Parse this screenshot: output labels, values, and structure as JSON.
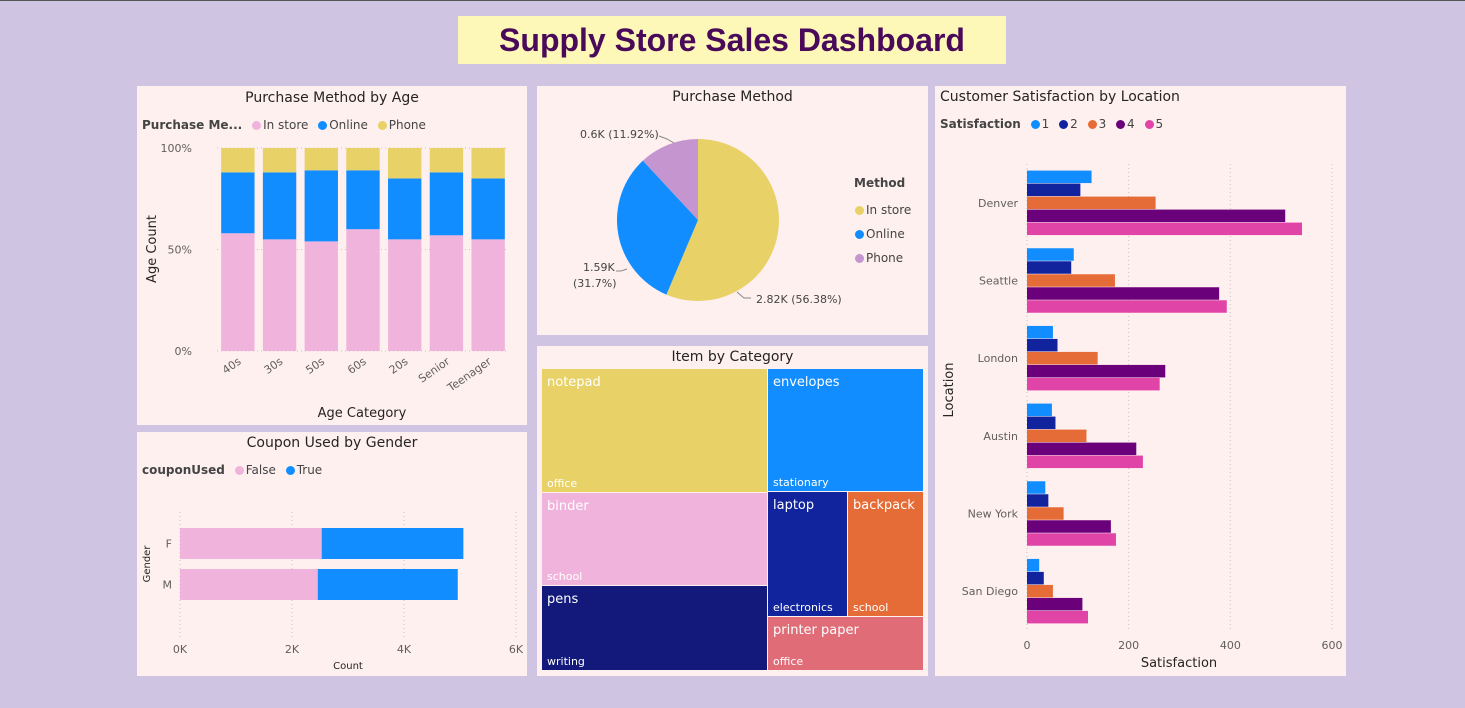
{
  "dashboard": {
    "title": "Supply Store Sales  Dashboard"
  },
  "age_chart": {
    "title": "Purchase Method by Age",
    "legend_title": "Purchase Me...",
    "legend": [
      {
        "name": "In store",
        "color": "#f0b4dc"
      },
      {
        "name": "Online",
        "color": "#118dff"
      },
      {
        "name": "Phone",
        "color": "#e8d166"
      }
    ]
  },
  "method_chart": {
    "title": "Purchase Method",
    "legend_title": "Method",
    "legend": [
      {
        "name": "In store",
        "color": "#e8d166"
      },
      {
        "name": "Online",
        "color": "#118dff"
      },
      {
        "name": "Phone",
        "color": "#c495ce"
      }
    ],
    "label_phone": "0.6K (11.92%)",
    "label_online_1": "1.59K",
    "label_online_2": "(31.7%)",
    "label_instore": "2.82K (56.38%)"
  },
  "satisfaction_chart": {
    "title": "Customer Satisfaction by Location",
    "legend_title": "Satisfaction",
    "legend": [
      {
        "name": "1",
        "color": "#118dff"
      },
      {
        "name": "2",
        "color": "#12239e"
      },
      {
        "name": "3",
        "color": "#e66c37"
      },
      {
        "name": "4",
        "color": "#6b007b"
      },
      {
        "name": "5",
        "color": "#e044a7"
      }
    ]
  },
  "coupon_chart": {
    "title": "Coupon Used by Gender",
    "legend_title": "couponUsed",
    "legend": [
      {
        "name": "False",
        "color": "#f0b4dc"
      },
      {
        "name": "True",
        "color": "#118dff"
      }
    ]
  },
  "category_chart": {
    "title": "Item by Category"
  },
  "chart_data": [
    {
      "type": "bar",
      "stacked": "100%",
      "title": "Purchase Method by Age",
      "xlabel": "Age Category",
      "ylabel": "Age Count",
      "yticks": [
        "0%",
        "50%",
        "100%"
      ],
      "categories": [
        "40s",
        "30s",
        "50s",
        "60s",
        "20s",
        "Senior",
        "Teenager"
      ],
      "series": [
        {
          "name": "In store",
          "color": "#f0b4dc",
          "values": [
            58,
            55,
            54,
            60,
            55,
            57,
            55
          ]
        },
        {
          "name": "Online",
          "color": "#118dff",
          "values": [
            30,
            33,
            35,
            29,
            30,
            31,
            30
          ]
        },
        {
          "name": "Phone",
          "color": "#e8d166",
          "values": [
            12,
            12,
            11,
            11,
            15,
            12,
            15
          ]
        }
      ]
    },
    {
      "type": "pie",
      "title": "Purchase Method",
      "slices": [
        {
          "name": "In store",
          "value": 2.82,
          "percent": 56.38,
          "color": "#e8d166"
        },
        {
          "name": "Online",
          "value": 1.59,
          "percent": 31.7,
          "color": "#118dff"
        },
        {
          "name": "Phone",
          "value": 0.6,
          "percent": 11.92,
          "color": "#c495ce"
        }
      ]
    },
    {
      "type": "bar",
      "orientation": "horizontal",
      "title": "Customer Satisfaction by Location",
      "xlabel": "Satisfaction",
      "ylabel": "Location",
      "xlim": [
        0,
        600
      ],
      "xticks": [
        "0",
        "200",
        "400",
        "600"
      ],
      "categories": [
        "Denver",
        "Seattle",
        "London",
        "Austin",
        "New York",
        "San Diego"
      ],
      "series": [
        {
          "name": "1",
          "color": "#118dff",
          "values": [
            127,
            92,
            51,
            49,
            36,
            24
          ]
        },
        {
          "name": "2",
          "color": "#12239e",
          "values": [
            105,
            87,
            60,
            56,
            42,
            33
          ]
        },
        {
          "name": "3",
          "color": "#e66c37",
          "values": [
            253,
            173,
            139,
            117,
            72,
            51
          ]
        },
        {
          "name": "4",
          "color": "#6b007b",
          "values": [
            508,
            378,
            272,
            215,
            165,
            109
          ]
        },
        {
          "name": "5",
          "color": "#e044a7",
          "values": [
            541,
            393,
            261,
            228,
            175,
            120
          ]
        }
      ]
    },
    {
      "type": "bar",
      "orientation": "horizontal",
      "stacked": true,
      "title": "Coupon Used by Gender",
      "xlabel": "Count",
      "ylabel": "Gender",
      "xlim": [
        0,
        6000
      ],
      "xticks": [
        "0K",
        "2K",
        "4K",
        "6K"
      ],
      "categories": [
        "F",
        "M"
      ],
      "series": [
        {
          "name": "False",
          "color": "#f0b4dc",
          "values": [
            2530,
            2460
          ]
        },
        {
          "name": "True",
          "color": "#118dff",
          "values": [
            2530,
            2500
          ]
        }
      ]
    },
    {
      "type": "treemap",
      "title": "Item by Category",
      "items": [
        {
          "item": "notepad",
          "category": "office",
          "color": "#e8d166"
        },
        {
          "item": "binder",
          "category": "school",
          "color": "#f0b4dc"
        },
        {
          "item": "pens",
          "category": "writing",
          "color": "#12197a"
        },
        {
          "item": "envelopes",
          "category": "stationary",
          "color": "#118dff"
        },
        {
          "item": "laptop",
          "category": "electronics",
          "color": "#12239e"
        },
        {
          "item": "backpack",
          "category": "school",
          "color": "#e66c37"
        },
        {
          "item": "printer paper",
          "category": "office",
          "color": "#df6c76"
        }
      ]
    }
  ]
}
